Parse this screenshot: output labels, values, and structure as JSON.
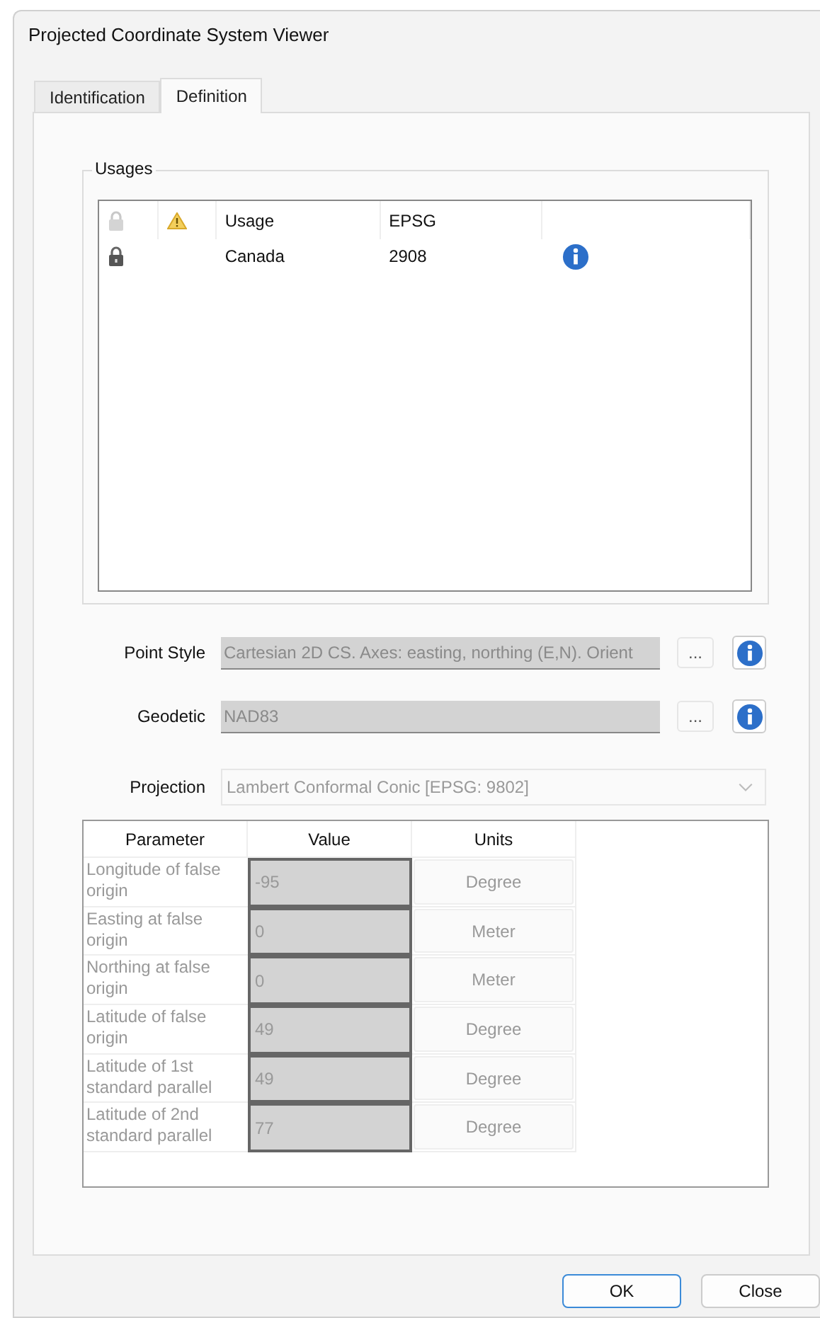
{
  "window": {
    "title": "Projected Coordinate System Viewer"
  },
  "tabs": [
    {
      "label": "Identification",
      "selected": false
    },
    {
      "label": "Definition",
      "selected": true
    }
  ],
  "usages": {
    "title": "Usages",
    "columns": [
      "Usage",
      "EPSG"
    ],
    "rows": [
      {
        "usage": "Canada",
        "epsg": "2908"
      }
    ]
  },
  "point_style": {
    "label": "Point Style",
    "value": "Cartesian 2D CS. Axes: easting, northing (E,N). Orient",
    "button": "..."
  },
  "geodetic": {
    "label": "Geodetic",
    "value": "NAD83",
    "button": "..."
  },
  "projection": {
    "label": "Projection",
    "value": "Lambert Conformal Conic [EPSG: 9802]"
  },
  "parameters": {
    "columns": [
      "Parameter",
      "Value",
      "Units"
    ],
    "rows": [
      {
        "parameter": "Longitude of false origin",
        "value": "-95",
        "units": "Degree"
      },
      {
        "parameter": "Easting at false origin",
        "value": "0",
        "units": "Meter"
      },
      {
        "parameter": "Northing at false origin",
        "value": "0",
        "units": "Meter"
      },
      {
        "parameter": "Latitude of false origin",
        "value": "49",
        "units": "Degree"
      },
      {
        "parameter": "Latitude of 1st standard parallel",
        "value": "49",
        "units": "Degree"
      },
      {
        "parameter": "Latitude of 2nd standard parallel",
        "value": "77",
        "units": "Degree"
      }
    ]
  },
  "buttons": [
    {
      "label": "OK",
      "default": true
    },
    {
      "label": "Close",
      "default": false
    }
  ]
}
